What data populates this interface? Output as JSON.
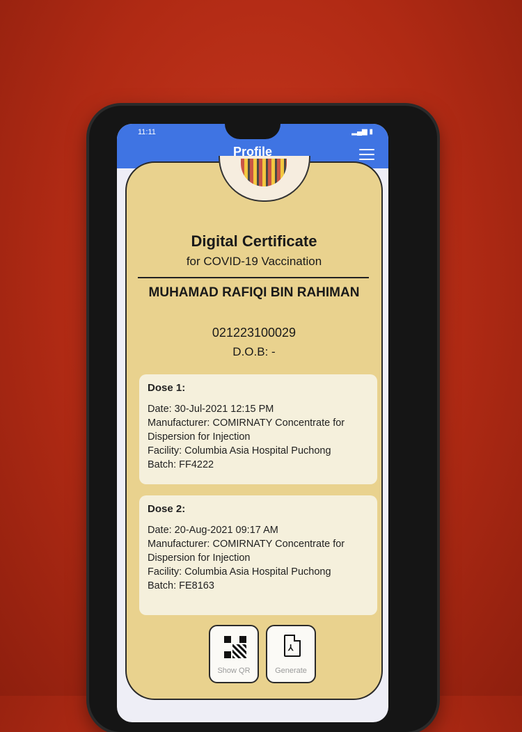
{
  "app": {
    "title": "Profile",
    "status_time": "11:11"
  },
  "certificate": {
    "title": "Digital Certificate",
    "subtitle": "for COVID-19 Vaccination",
    "name": "MUHAMAD RAFIQI BIN RAHIMAN",
    "id_number": "021223100029",
    "dob": "D.O.B: -"
  },
  "doses": [
    {
      "title": "Dose 1:",
      "date": "Date: 30-Jul-2021 12:15 PM",
      "manufacturer": "Manufacturer: COMIRNATY Concentrate for Dispersion for Injection",
      "facility": "Facility: Columbia Asia Hospital Puchong",
      "batch": "Batch: FF4222"
    },
    {
      "title": "Dose 2:",
      "date": "Date: 20-Aug-2021 09:17 AM",
      "manufacturer": "Manufacturer: COMIRNATY Concentrate for Dispersion for Injection",
      "facility": "Facility: Columbia Asia Hospital Puchong",
      "batch": "Batch: FE8163"
    }
  ],
  "actions": {
    "show_qr": "Show QR",
    "generate": "Generate"
  },
  "icons": [
    "menu-icon",
    "qr-code-icon",
    "pdf-icon",
    "coat-of-arms-icon"
  ],
  "colors": {
    "appbar": "#3f74e3",
    "card": "#e9d28e",
    "dose_card": "#f5f0dc"
  }
}
